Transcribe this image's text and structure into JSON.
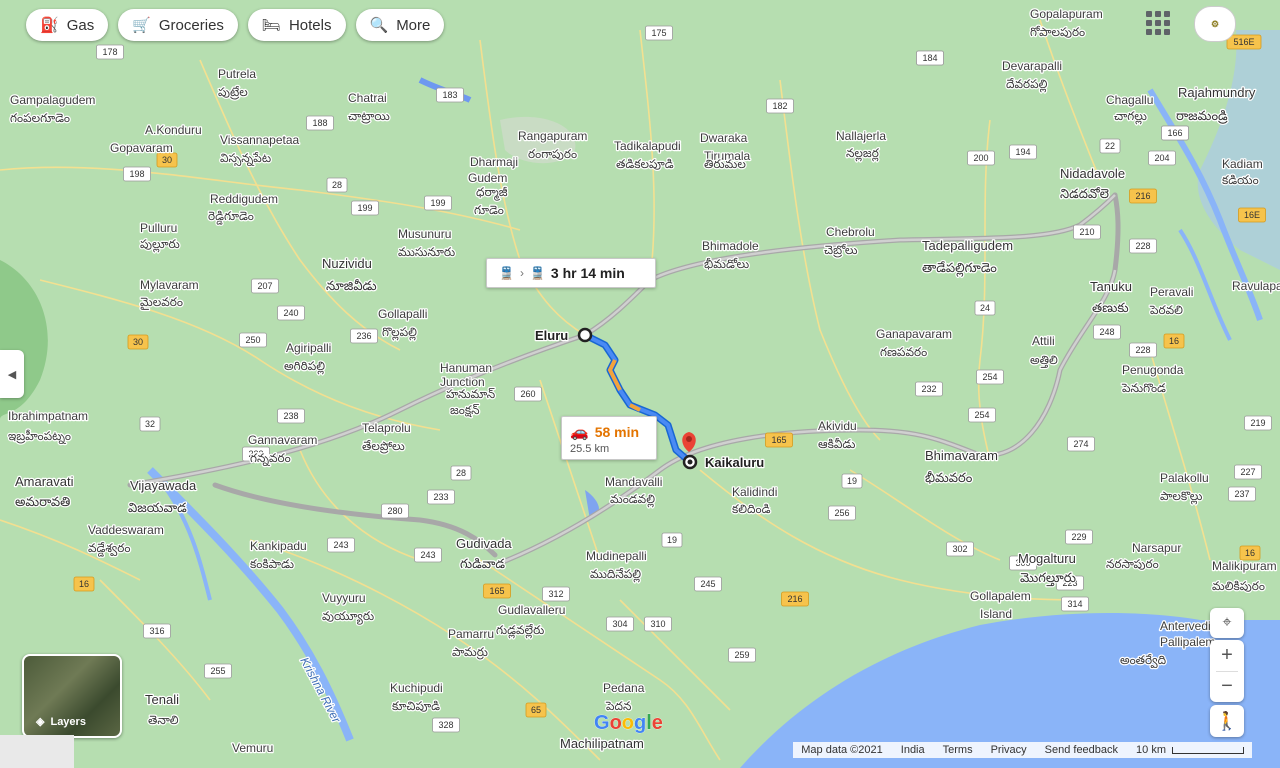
{
  "chips": [
    {
      "label": "Gas",
      "icon": "gas-station-icon"
    },
    {
      "label": "Groceries",
      "icon": "cart-icon"
    },
    {
      "label": "Hotels",
      "icon": "bed-icon"
    },
    {
      "label": "More",
      "icon": "search-icon"
    }
  ],
  "avatar_text": "⚙",
  "transit": {
    "time": "3 hr 14 min"
  },
  "drive": {
    "time": "58 min",
    "distance": "25.5 km"
  },
  "layers_label": "Layers",
  "footer": {
    "map_data": "Map data ©2021",
    "region": "India",
    "terms": "Terms",
    "privacy": "Privacy",
    "feedback": "Send feedback",
    "scale": "10 km"
  },
  "logo": "Google",
  "places": [
    {
      "name": "Eluru"
    },
    {
      "name": "Kaikaluru"
    },
    {
      "name": "Vijayawada"
    },
    {
      "name": "విజయవాడ"
    },
    {
      "name": "Amaravati"
    },
    {
      "name": "అమరావతి"
    },
    {
      "name": "Gudivada"
    },
    {
      "name": "గుడివాడ"
    },
    {
      "name": "Bhimavaram"
    },
    {
      "name": "భీమవరం"
    },
    {
      "name": "Tadepalligudem"
    },
    {
      "name": "తాడేపల్లిగూడెం"
    },
    {
      "name": "Tanuku"
    },
    {
      "name": "తణుకు"
    },
    {
      "name": "Nidadavole"
    },
    {
      "name": "నిడదవోలె"
    },
    {
      "name": "Rajahmundry"
    },
    {
      "name": "రాజమండ్రి"
    },
    {
      "name": "Nuzividu"
    },
    {
      "name": "నూజివీడు"
    },
    {
      "name": "Machilipatnam"
    },
    {
      "name": "Akividu"
    },
    {
      "name": "ఆకివీడు"
    },
    {
      "name": "Mandavalli"
    },
    {
      "name": "మండవల్లి"
    },
    {
      "name": "Kalidindi"
    },
    {
      "name": "కలిదిండి"
    },
    {
      "name": "Mudinepalli"
    },
    {
      "name": "ముదినేపల్లి"
    },
    {
      "name": "Gudlavalleru"
    },
    {
      "name": "గుడ్లవల్లేరు"
    },
    {
      "name": "Pamarru"
    },
    {
      "name": "పామర్రు"
    },
    {
      "name": "Pedana"
    },
    {
      "name": "పెదన"
    },
    {
      "name": "Kuchipudi"
    },
    {
      "name": "కూచిపూడి"
    },
    {
      "name": "Tenali"
    },
    {
      "name": "తెనాలి"
    },
    {
      "name": "Vemuru"
    },
    {
      "name": "Vuyyuru"
    },
    {
      "name": "వుయ్యూరు"
    },
    {
      "name": "Kankipadu"
    },
    {
      "name": "కంకిపాడు"
    },
    {
      "name": "Vaddeswaram"
    },
    {
      "name": "వడ్డేశ్వరం"
    },
    {
      "name": "Ibrahimpatnam"
    },
    {
      "name": "ఇబ్రహీంపట్నం"
    },
    {
      "name": "Gannavaram"
    },
    {
      "name": "గన్నవరం"
    },
    {
      "name": "Telaprolu"
    },
    {
      "name": "తేలప్రోలు"
    },
    {
      "name": "Hanuman"
    },
    {
      "name": "Junction"
    },
    {
      "name": "హనుమాన్"
    },
    {
      "name": "జంక్షన్"
    },
    {
      "name": "Agiripalli"
    },
    {
      "name": "అగిరిపల్లి"
    },
    {
      "name": "Gollapalli"
    },
    {
      "name": "గొల్లపల్లి"
    },
    {
      "name": "Musunuru"
    },
    {
      "name": "ముసునూరు"
    },
    {
      "name": "Mylavaram"
    },
    {
      "name": "మైలవరం"
    },
    {
      "name": "Pulluru"
    },
    {
      "name": "పుల్లూరు"
    },
    {
      "name": "Reddigudem"
    },
    {
      "name": "రెడ్డిగూడెం"
    },
    {
      "name": "Vissannapetaa"
    },
    {
      "name": "విస్సన్నపేట"
    },
    {
      "name": "A.Konduru"
    },
    {
      "name": "Gopavaram"
    },
    {
      "name": "Gampalagudem"
    },
    {
      "name": "గంపలగూడెం"
    },
    {
      "name": "Putrela"
    },
    {
      "name": "పుట్రేల"
    },
    {
      "name": "Chatrai"
    },
    {
      "name": "చాట్రాయి"
    },
    {
      "name": "Rangapuram"
    },
    {
      "name": "రంగాపురం"
    },
    {
      "name": "Dharmaji"
    },
    {
      "name": "Gudem"
    },
    {
      "name": "ధర్మాజీ"
    },
    {
      "name": "గూడెం"
    },
    {
      "name": "Tadikalapudi"
    },
    {
      "name": "తడికలపూడి"
    },
    {
      "name": "Dwaraka"
    },
    {
      "name": "Tirumala"
    },
    {
      "name": "తిరుమల"
    },
    {
      "name": "Nallajerla"
    },
    {
      "name": "నల్లజర్ల"
    },
    {
      "name": "Devarapalli"
    },
    {
      "name": "దేవరపల్లి"
    },
    {
      "name": "Gopalapuram"
    },
    {
      "name": "గోపాలపురం"
    },
    {
      "name": "Chagallu"
    },
    {
      "name": "చాగల్లు"
    },
    {
      "name": "Chebrolu"
    },
    {
      "name": "చెబ్రోలు"
    },
    {
      "name": "Bhimadole"
    },
    {
      "name": "భీమడోలు"
    },
    {
      "name": "Ganapavaram"
    },
    {
      "name": "గణపవరం"
    },
    {
      "name": "Attili"
    },
    {
      "name": "అత్తిలి"
    },
    {
      "name": "Peravali"
    },
    {
      "name": "పెరవలి"
    },
    {
      "name": "Penugonda"
    },
    {
      "name": "పెనుగొండ"
    },
    {
      "name": "Palakollu"
    },
    {
      "name": "పాలకొల్లు"
    },
    {
      "name": "Narsapur"
    },
    {
      "name": "నరసాపురం"
    },
    {
      "name": "Mogalturu"
    },
    {
      "name": "మొగల్తూరు"
    },
    {
      "name": "Gollapalem"
    },
    {
      "name": "Island"
    },
    {
      "name": "Antervedi"
    },
    {
      "name": "Pallipalem"
    },
    {
      "name": "అంతర్వేది"
    },
    {
      "name": "Malikipuram"
    },
    {
      "name": "మలికిపురం"
    },
    {
      "name": "Ravulapalem"
    },
    {
      "name": "Kadiam"
    },
    {
      "name": "కడియం"
    },
    {
      "name": "Krishna River"
    }
  ],
  "shields": [
    "178",
    "175",
    "183",
    "188",
    "182",
    "184",
    "198",
    "30",
    "28",
    "199",
    "199",
    "207",
    "240",
    "236",
    "250",
    "30",
    "32",
    "238",
    "223",
    "260",
    "28",
    "233",
    "280",
    "243",
    "243",
    "165",
    "165",
    "312",
    "19",
    "245",
    "304",
    "310",
    "216",
    "316",
    "255",
    "259",
    "65",
    "328",
    "184",
    "194",
    "200",
    "210",
    "22",
    "166",
    "166",
    "204",
    "228",
    "216",
    "24",
    "232",
    "254",
    "254",
    "248",
    "228",
    "16",
    "16",
    "274",
    "227",
    "219",
    "19",
    "256",
    "237",
    "302",
    "300",
    "229",
    "314",
    "223",
    "516E",
    "16E",
    "16"
  ]
}
